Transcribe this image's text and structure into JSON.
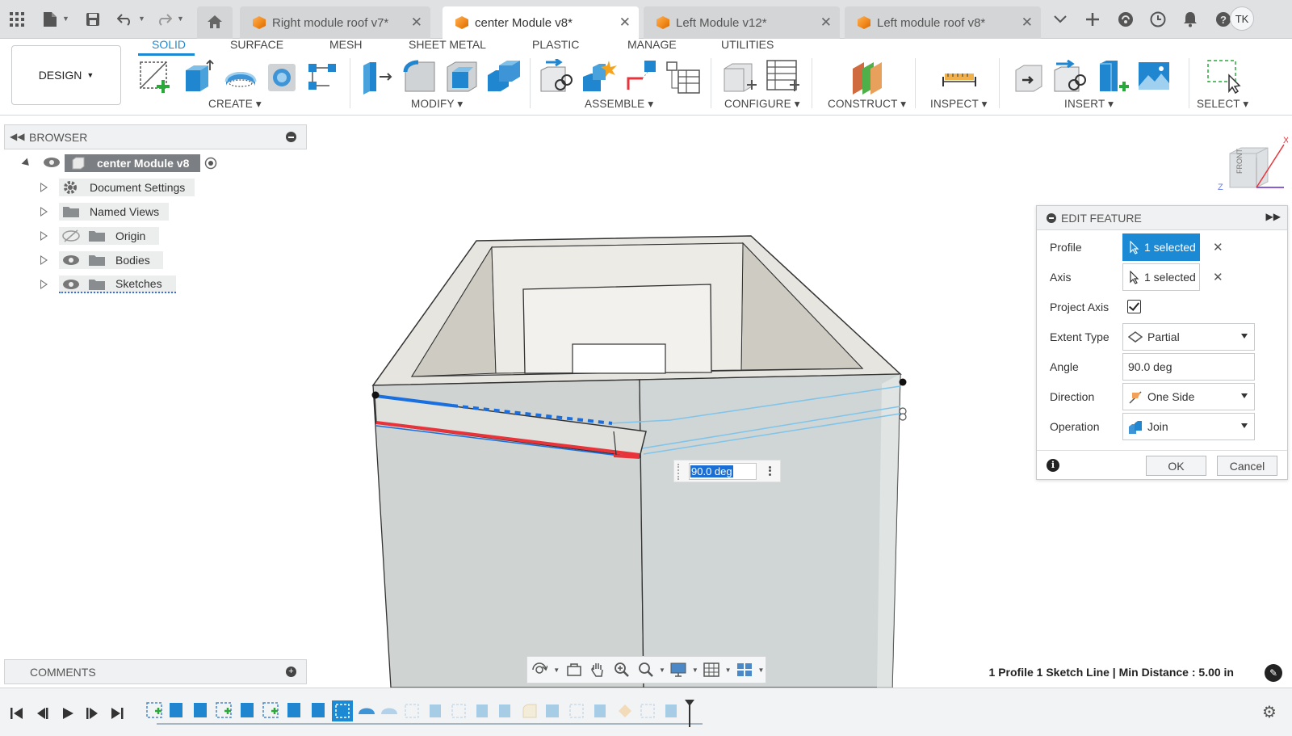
{
  "tabs": [
    {
      "label": "Right module roof v7*",
      "active": false
    },
    {
      "label": "center Module v8*",
      "active": true
    },
    {
      "label": "Left Module v12*",
      "active": false
    },
    {
      "label": "Left module roof v8*",
      "active": false
    }
  ],
  "user": {
    "initials": "TK"
  },
  "toolbar": {
    "design_label": "DESIGN",
    "workspace_tabs": [
      "SOLID",
      "SURFACE",
      "MESH",
      "SHEET METAL",
      "PLASTIC",
      "MANAGE",
      "UTILITIES"
    ],
    "active_workspace": "SOLID",
    "groups": [
      "CREATE",
      "MODIFY",
      "ASSEMBLE",
      "CONFIGURE",
      "CONSTRUCT",
      "INSPECT",
      "INSERT",
      "SELECT"
    ]
  },
  "browser": {
    "title": "BROWSER",
    "root": "center Module v8",
    "items": [
      "Document Settings",
      "Named Views",
      "Origin",
      "Bodies",
      "Sketches"
    ]
  },
  "comments": {
    "title": "COMMENTS"
  },
  "edit_feature": {
    "title": "EDIT FEATURE",
    "profile_label": "Profile",
    "profile_value": "1 selected",
    "axis_label": "Axis",
    "axis_value": "1 selected",
    "project_axis_label": "Project Axis",
    "project_axis_checked": true,
    "extent_type_label": "Extent Type",
    "extent_type_value": "Partial",
    "angle_label": "Angle",
    "angle_value": "90.0 deg",
    "direction_label": "Direction",
    "direction_value": "One Side",
    "operation_label": "Operation",
    "operation_value": "Join",
    "ok_label": "OK",
    "cancel_label": "Cancel"
  },
  "viewport": {
    "angle_input": "90.0 deg",
    "viewcube_face": "FRONT",
    "axis_x": "X",
    "axis_z": "Z"
  },
  "status": {
    "text": "1 Profile 1 Sketch Line | Min Distance : 5.00 in"
  },
  "colors": {
    "accent": "#1b89d3",
    "selection_red": "#e8333b",
    "selection_blue": "#1a6fe0",
    "preview_blue": "#7fc4ea"
  }
}
